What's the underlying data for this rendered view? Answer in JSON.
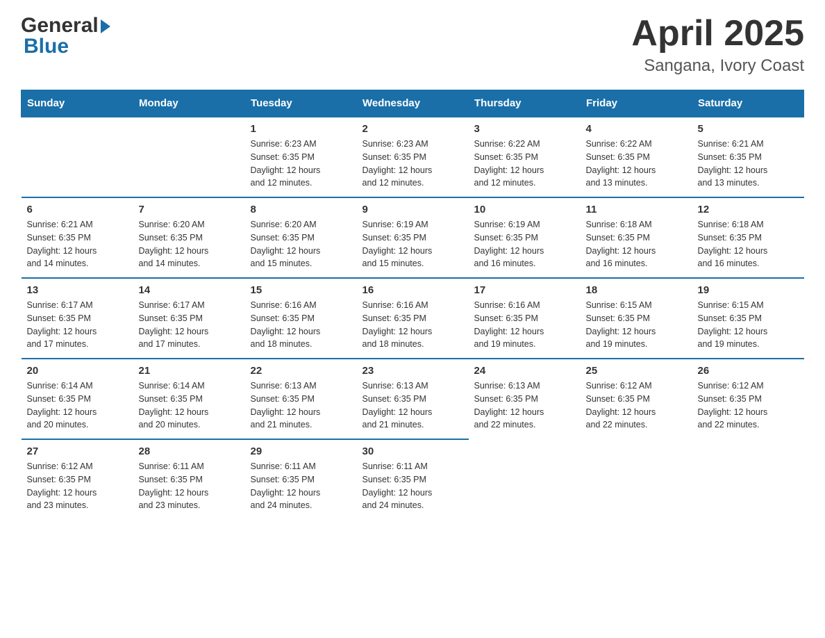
{
  "logo": {
    "part1": "General",
    "part2": "Blue"
  },
  "title": "April 2025",
  "subtitle": "Sangana, Ivory Coast",
  "days": [
    "Sunday",
    "Monday",
    "Tuesday",
    "Wednesday",
    "Thursday",
    "Friday",
    "Saturday"
  ],
  "weeks": [
    [
      {
        "day": "",
        "info": ""
      },
      {
        "day": "",
        "info": ""
      },
      {
        "day": "1",
        "sunrise": "6:23 AM",
        "sunset": "6:35 PM",
        "daylight": "12 hours and 12 minutes."
      },
      {
        "day": "2",
        "sunrise": "6:23 AM",
        "sunset": "6:35 PM",
        "daylight": "12 hours and 12 minutes."
      },
      {
        "day": "3",
        "sunrise": "6:22 AM",
        "sunset": "6:35 PM",
        "daylight": "12 hours and 12 minutes."
      },
      {
        "day": "4",
        "sunrise": "6:22 AM",
        "sunset": "6:35 PM",
        "daylight": "12 hours and 13 minutes."
      },
      {
        "day": "5",
        "sunrise": "6:21 AM",
        "sunset": "6:35 PM",
        "daylight": "12 hours and 13 minutes."
      }
    ],
    [
      {
        "day": "6",
        "sunrise": "6:21 AM",
        "sunset": "6:35 PM",
        "daylight": "12 hours and 14 minutes."
      },
      {
        "day": "7",
        "sunrise": "6:20 AM",
        "sunset": "6:35 PM",
        "daylight": "12 hours and 14 minutes."
      },
      {
        "day": "8",
        "sunrise": "6:20 AM",
        "sunset": "6:35 PM",
        "daylight": "12 hours and 15 minutes."
      },
      {
        "day": "9",
        "sunrise": "6:19 AM",
        "sunset": "6:35 PM",
        "daylight": "12 hours and 15 minutes."
      },
      {
        "day": "10",
        "sunrise": "6:19 AM",
        "sunset": "6:35 PM",
        "daylight": "12 hours and 16 minutes."
      },
      {
        "day": "11",
        "sunrise": "6:18 AM",
        "sunset": "6:35 PM",
        "daylight": "12 hours and 16 minutes."
      },
      {
        "day": "12",
        "sunrise": "6:18 AM",
        "sunset": "6:35 PM",
        "daylight": "12 hours and 16 minutes."
      }
    ],
    [
      {
        "day": "13",
        "sunrise": "6:17 AM",
        "sunset": "6:35 PM",
        "daylight": "12 hours and 17 minutes."
      },
      {
        "day": "14",
        "sunrise": "6:17 AM",
        "sunset": "6:35 PM",
        "daylight": "12 hours and 17 minutes."
      },
      {
        "day": "15",
        "sunrise": "6:16 AM",
        "sunset": "6:35 PM",
        "daylight": "12 hours and 18 minutes."
      },
      {
        "day": "16",
        "sunrise": "6:16 AM",
        "sunset": "6:35 PM",
        "daylight": "12 hours and 18 minutes."
      },
      {
        "day": "17",
        "sunrise": "6:16 AM",
        "sunset": "6:35 PM",
        "daylight": "12 hours and 19 minutes."
      },
      {
        "day": "18",
        "sunrise": "6:15 AM",
        "sunset": "6:35 PM",
        "daylight": "12 hours and 19 minutes."
      },
      {
        "day": "19",
        "sunrise": "6:15 AM",
        "sunset": "6:35 PM",
        "daylight": "12 hours and 19 minutes."
      }
    ],
    [
      {
        "day": "20",
        "sunrise": "6:14 AM",
        "sunset": "6:35 PM",
        "daylight": "12 hours and 20 minutes."
      },
      {
        "day": "21",
        "sunrise": "6:14 AM",
        "sunset": "6:35 PM",
        "daylight": "12 hours and 20 minutes."
      },
      {
        "day": "22",
        "sunrise": "6:13 AM",
        "sunset": "6:35 PM",
        "daylight": "12 hours and 21 minutes."
      },
      {
        "day": "23",
        "sunrise": "6:13 AM",
        "sunset": "6:35 PM",
        "daylight": "12 hours and 21 minutes."
      },
      {
        "day": "24",
        "sunrise": "6:13 AM",
        "sunset": "6:35 PM",
        "daylight": "12 hours and 22 minutes."
      },
      {
        "day": "25",
        "sunrise": "6:12 AM",
        "sunset": "6:35 PM",
        "daylight": "12 hours and 22 minutes."
      },
      {
        "day": "26",
        "sunrise": "6:12 AM",
        "sunset": "6:35 PM",
        "daylight": "12 hours and 22 minutes."
      }
    ],
    [
      {
        "day": "27",
        "sunrise": "6:12 AM",
        "sunset": "6:35 PM",
        "daylight": "12 hours and 23 minutes."
      },
      {
        "day": "28",
        "sunrise": "6:11 AM",
        "sunset": "6:35 PM",
        "daylight": "12 hours and 23 minutes."
      },
      {
        "day": "29",
        "sunrise": "6:11 AM",
        "sunset": "6:35 PM",
        "daylight": "12 hours and 24 minutes."
      },
      {
        "day": "30",
        "sunrise": "6:11 AM",
        "sunset": "6:35 PM",
        "daylight": "12 hours and 24 minutes."
      },
      {
        "day": "",
        "info": ""
      },
      {
        "day": "",
        "info": ""
      },
      {
        "day": "",
        "info": ""
      }
    ]
  ],
  "labels": {
    "sunrise_prefix": "Sunrise: ",
    "sunset_prefix": "Sunset: ",
    "daylight_prefix": "Daylight: "
  }
}
